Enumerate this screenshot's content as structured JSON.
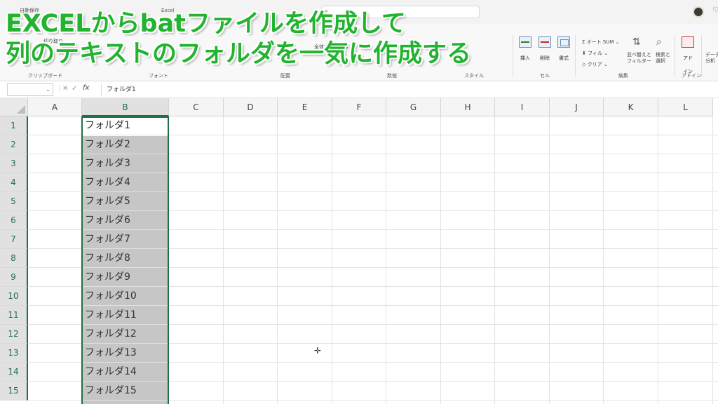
{
  "titlebar": {
    "autosave": "自動保存",
    "app_name": "Excel"
  },
  "ribbon": {
    "cut": "切り取り",
    "wrap": "全体を表示する",
    "autosum": "オート SUM",
    "fill": "フィル",
    "clear": "クリア",
    "sort_filter": "並べ替えと\nフィルター",
    "find_select": "検索と\n選択",
    "insert": "挿入",
    "delete": "削除",
    "format": "書式",
    "addin": "アド\nイン",
    "data_analysis": "データ\n分析",
    "groups": {
      "clipboard": "クリップボード",
      "font": "フォント",
      "alignment": "配置",
      "number": "数値",
      "styles": "スタイル",
      "cells": "セル",
      "editing": "編集",
      "addins": "アドイン"
    }
  },
  "overlay": {
    "line1": "EXCELからbatファイルを作成して",
    "line2": "列のテキストのフォルダを一気に作成する"
  },
  "formula_bar": {
    "fx": "fx",
    "content": "フォルダ1"
  },
  "grid": {
    "columns": [
      "A",
      "B",
      "C",
      "D",
      "E",
      "F",
      "G",
      "H",
      "I",
      "J",
      "K",
      "L"
    ],
    "rows": [
      "1",
      "2",
      "3",
      "4",
      "5",
      "6",
      "7",
      "8",
      "9",
      "10",
      "11",
      "12",
      "13",
      "14",
      "15"
    ],
    "column_b": [
      "フォルダ1",
      "フォルダ2",
      "フォルダ3",
      "フォルダ4",
      "フォルダ5",
      "フォルダ6",
      "フォルダ7",
      "フォルダ8",
      "フォルダ9",
      "フォルダ10",
      "フォルダ11",
      "フォルダ12",
      "フォルダ13",
      "フォルダ14",
      "フォルダ15"
    ]
  },
  "colors": {
    "accent_green": "#1e7145",
    "overlay_green": "#22b32f",
    "selection_fill": "#c6c6c6"
  }
}
